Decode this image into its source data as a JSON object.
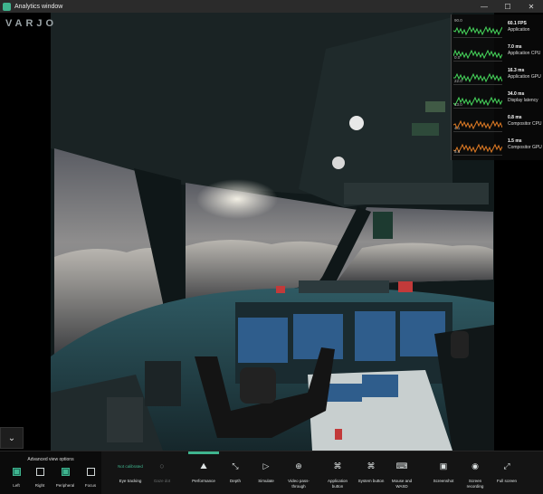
{
  "window": {
    "title": "Analytics window",
    "minimize": "—",
    "maximize": "☐",
    "close": "✕"
  },
  "logo": "VARJO",
  "perf": {
    "rows": [
      {
        "scale_top": "90.0",
        "scale_bottom": "",
        "value": "60.1 FPS",
        "label": "Application",
        "color": "#46d65b"
      },
      {
        "scale_top": "",
        "scale_bottom": "0.0",
        "value": "7.0 ms",
        "label": "Application CPU",
        "color": "#46d65b"
      },
      {
        "scale_top": "",
        "scale_bottom": "22.0",
        "value": "16.3 ms",
        "label": "Application GPU",
        "color": "#46d65b"
      },
      {
        "scale_top": "",
        "scale_bottom": "13.0",
        "value": "34.0 ms",
        "label": "Display latency",
        "color": "#46d65b"
      },
      {
        "scale_top": "",
        "scale_bottom": "4.1",
        "value": "0.8 ms",
        "label": "Compositor CPU",
        "color": "#e07b24"
      },
      {
        "scale_top": "",
        "scale_bottom": "5.4",
        "value": "1.5 ms",
        "label": "Compositor GPU",
        "color": "#e07b24"
      }
    ]
  },
  "collapse_icon": "⌄",
  "advanced": {
    "title": "Advanced view options",
    "options": [
      {
        "label": "Left",
        "checked": true
      },
      {
        "label": "Right",
        "checked": false
      },
      {
        "label": "Peripheral",
        "checked": true
      },
      {
        "label": "Focus",
        "checked": false
      }
    ]
  },
  "toolbar": {
    "eye_tracking": {
      "status": "Not calibrated",
      "label": "Eye tracking"
    },
    "gaze_dot": {
      "label": "Gaze dot",
      "icon": "○"
    },
    "items": [
      {
        "label": "Performance",
        "icon": "⛰"
      },
      {
        "label": "Depth",
        "icon": "⤡"
      },
      {
        "label": "Simulate",
        "icon": "▷"
      },
      {
        "label": "Video pass-through",
        "icon": "⊕"
      },
      {
        "label": "Application button",
        "icon": "⌘"
      },
      {
        "label": "System button",
        "icon": "⌘"
      },
      {
        "label": "Mouse and WASD",
        "icon": "⌨"
      },
      {
        "label": "Screenshot",
        "icon": "▣"
      },
      {
        "label": "Screen recording",
        "icon": "◉"
      },
      {
        "label": "Full screen",
        "icon": "⤢"
      }
    ]
  }
}
